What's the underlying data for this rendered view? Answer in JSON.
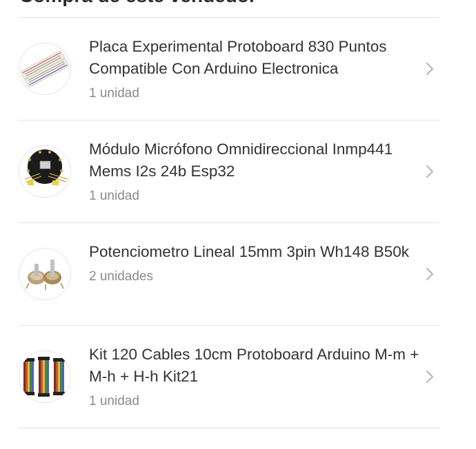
{
  "header": {
    "title": "Compra de este vendedor"
  },
  "items": [
    {
      "title": "Placa Experimental Protoboard 830 Puntos Compatible Con Arduino Electronica",
      "quantity": "1 unidad",
      "icon": "breadboard-thumbnail"
    },
    {
      "title": "Módulo Micrófono Omnidireccional Inmp441 Mems I2s 24b Esp32",
      "quantity": "1 unidad",
      "icon": "microphone-module-thumbnail"
    },
    {
      "title": "Potenciometro Lineal 15mm 3pin Wh148 B50k",
      "quantity": "2 unidades",
      "icon": "potentiometer-thumbnail"
    },
    {
      "title": "Kit 120 Cables 10cm Protoboard Arduino M-m + M-h + H-h Kit21",
      "quantity": "1 unidad",
      "icon": "jumper-cables-thumbnail"
    }
  ],
  "colors": {
    "divider": "#e3e3e3",
    "chevron": "#b5b5b5",
    "secondary_text": "#8a8a8a"
  }
}
